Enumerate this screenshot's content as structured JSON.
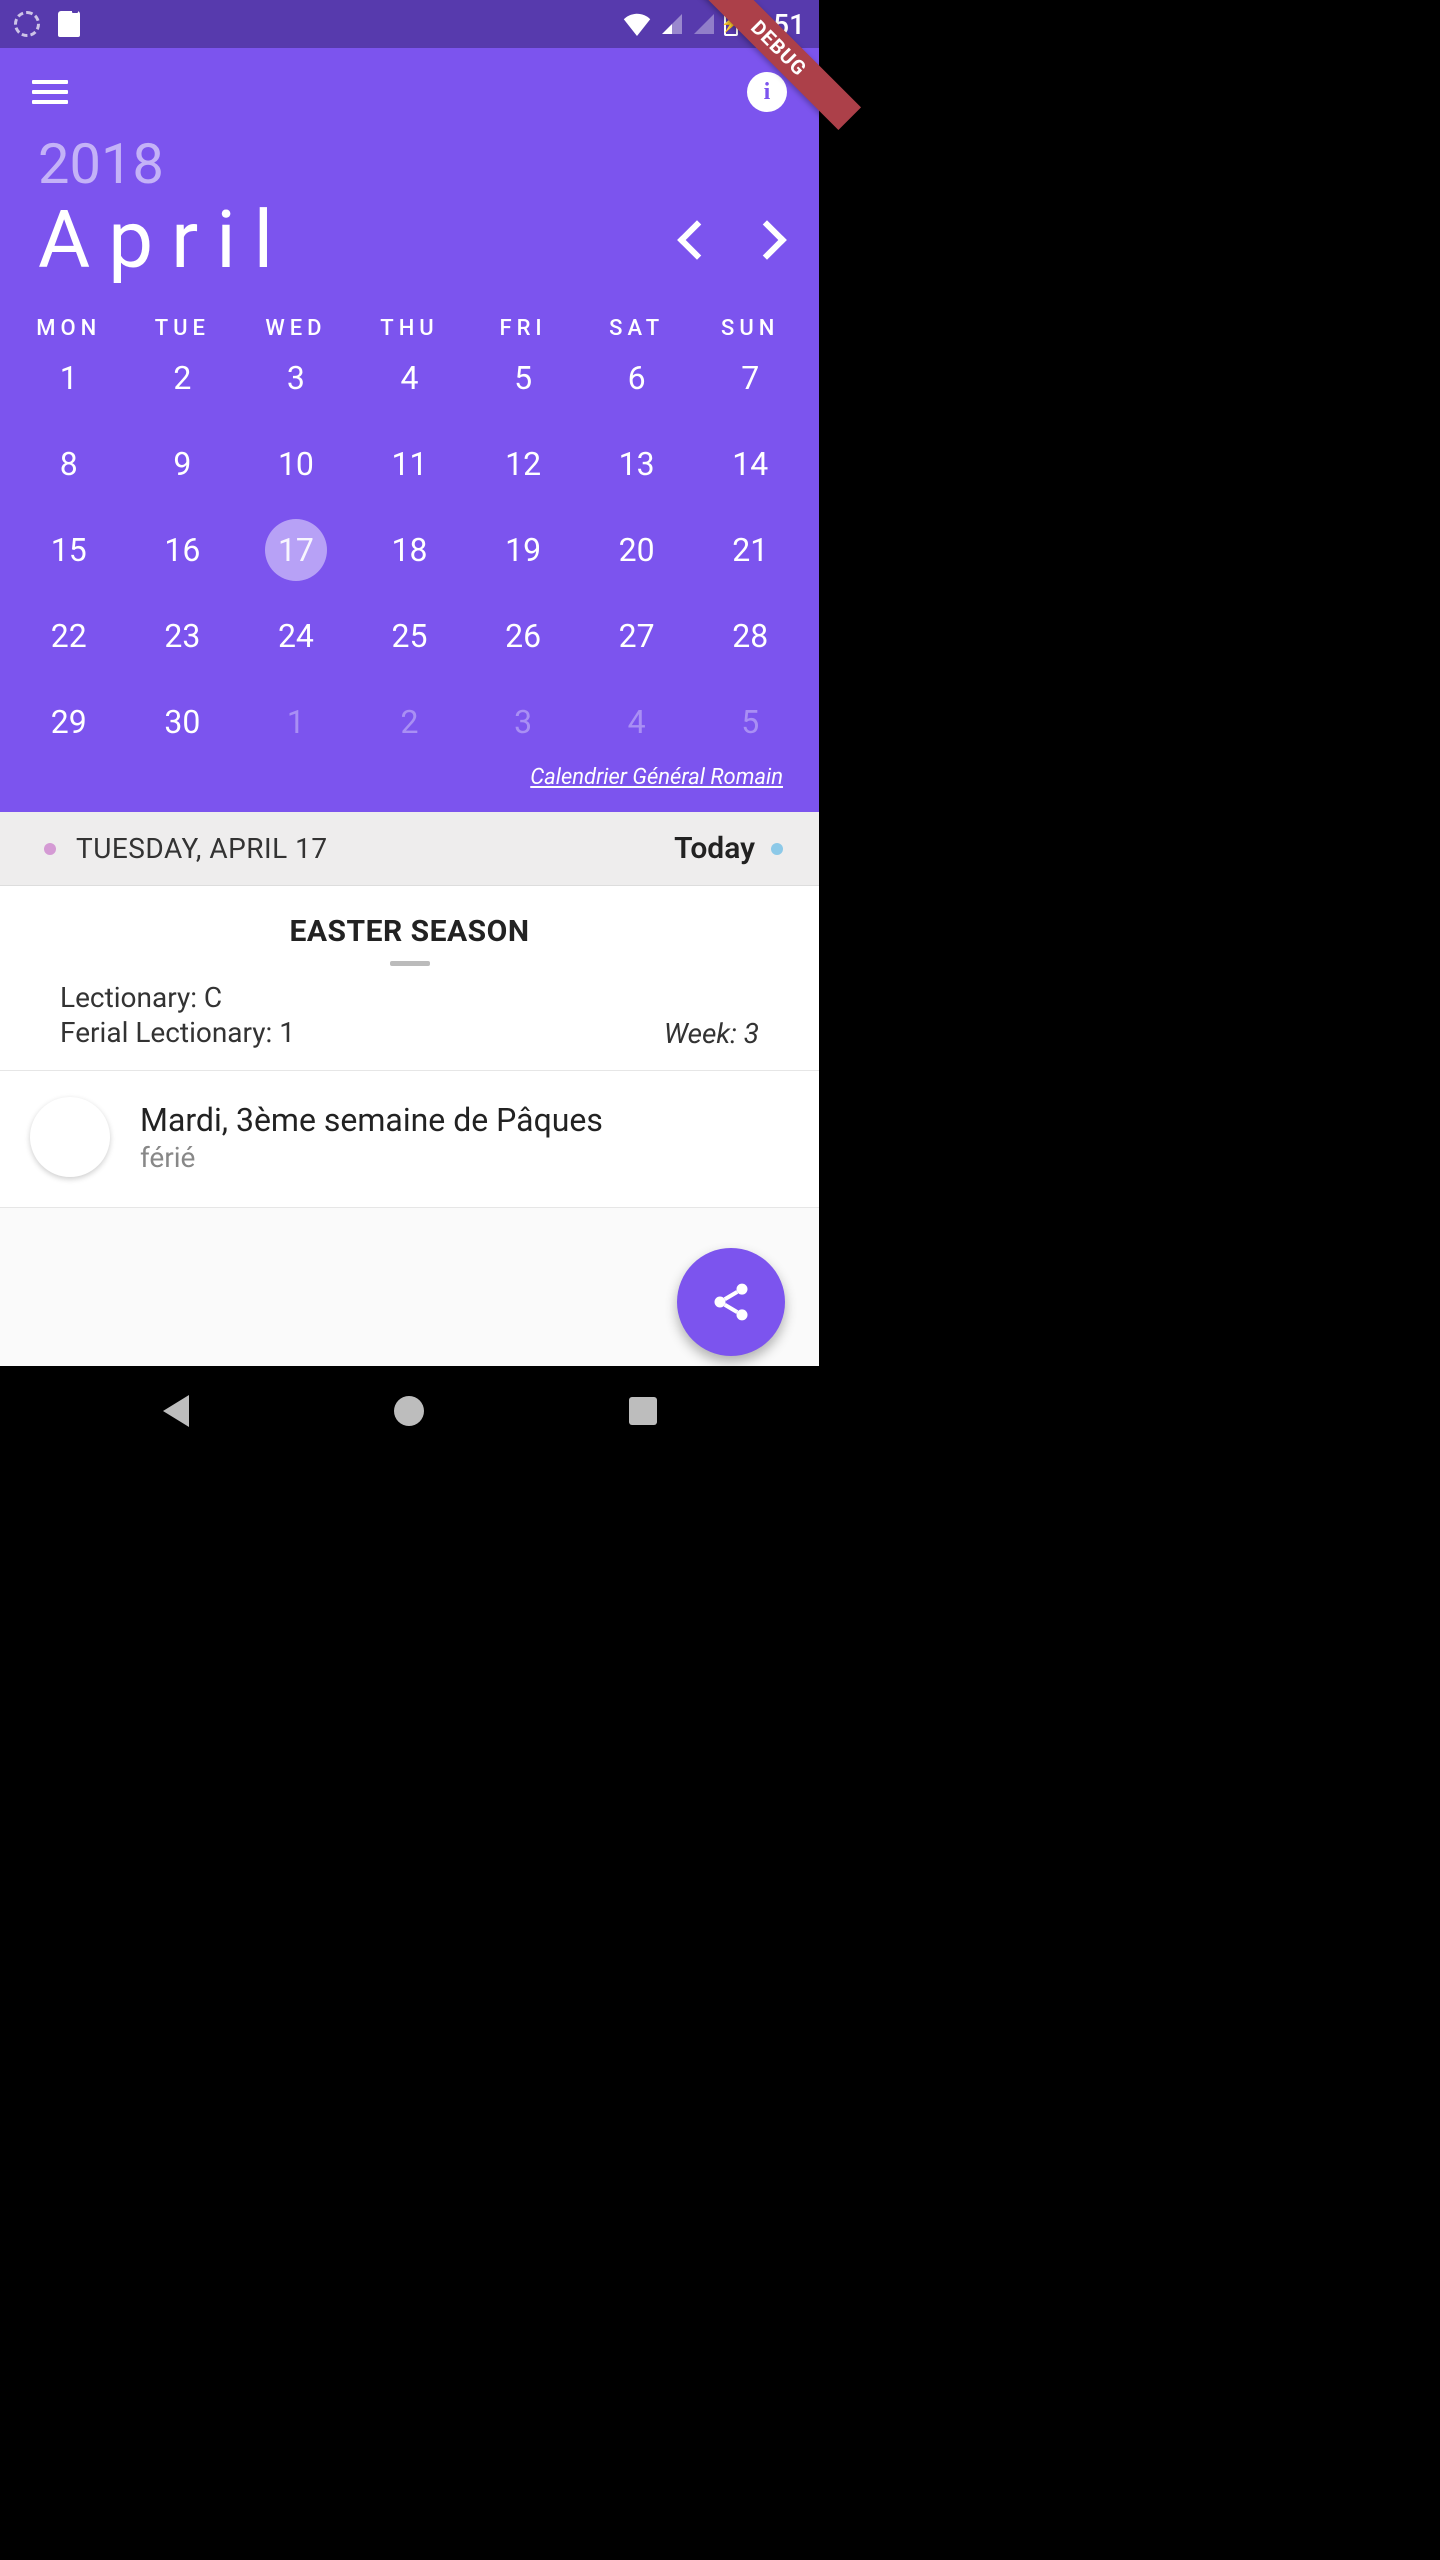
{
  "status": {
    "time": "4:51"
  },
  "debug_label": "DEBUG",
  "header": {
    "year": "2018",
    "month": "April",
    "calendar_link": "Calendrier Général Romain"
  },
  "dow": [
    "MON",
    "TUE",
    "WED",
    "THU",
    "FRI",
    "SAT",
    "SUN"
  ],
  "days": [
    {
      "n": "1"
    },
    {
      "n": "2"
    },
    {
      "n": "3"
    },
    {
      "n": "4"
    },
    {
      "n": "5"
    },
    {
      "n": "6"
    },
    {
      "n": "7"
    },
    {
      "n": "8"
    },
    {
      "n": "9"
    },
    {
      "n": "10"
    },
    {
      "n": "11"
    },
    {
      "n": "12"
    },
    {
      "n": "13"
    },
    {
      "n": "14"
    },
    {
      "n": "15"
    },
    {
      "n": "16"
    },
    {
      "n": "17",
      "selected": true
    },
    {
      "n": "18"
    },
    {
      "n": "19"
    },
    {
      "n": "20"
    },
    {
      "n": "21"
    },
    {
      "n": "22"
    },
    {
      "n": "23"
    },
    {
      "n": "24"
    },
    {
      "n": "25"
    },
    {
      "n": "26"
    },
    {
      "n": "27"
    },
    {
      "n": "28"
    },
    {
      "n": "29"
    },
    {
      "n": "30"
    },
    {
      "n": "1",
      "out": true
    },
    {
      "n": "2",
      "out": true
    },
    {
      "n": "3",
      "out": true
    },
    {
      "n": "4",
      "out": true
    },
    {
      "n": "5",
      "out": true
    }
  ],
  "datebar": {
    "date_label": "TUESDAY, APRIL 17",
    "today_label": "Today"
  },
  "season": {
    "title": "EASTER SEASON",
    "lectionary": "Lectionary: C",
    "ferial": "Ferial Lectionary: 1",
    "week": "Week: 3"
  },
  "event": {
    "title": "Mardi, 3ème semaine de Pâques",
    "subtitle": "férié"
  }
}
